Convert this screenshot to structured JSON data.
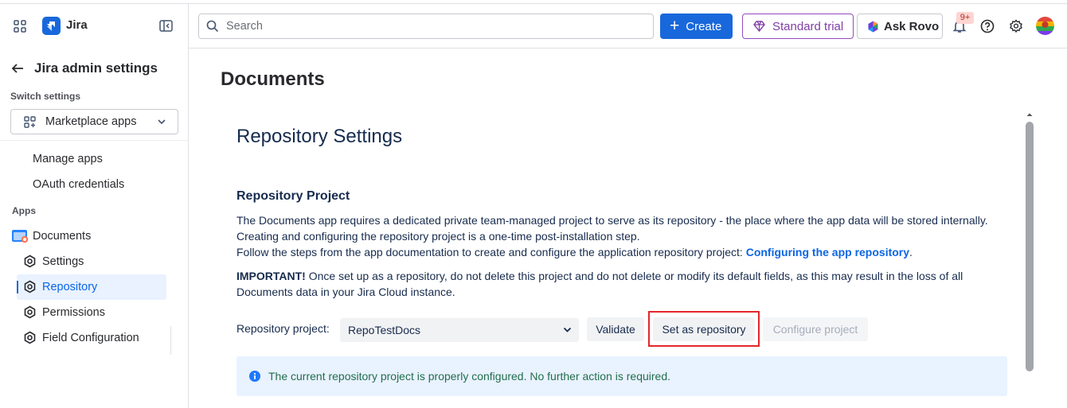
{
  "app": {
    "name": "Jira"
  },
  "sidebar": {
    "back_title": "Jira admin settings",
    "switch_settings_label": "Switch settings",
    "switch_value": "Marketplace apps",
    "items": [
      {
        "label": "Manage apps"
      },
      {
        "label": "OAuth credentials"
      }
    ],
    "apps_label": "Apps",
    "app_name": "Documents",
    "app_items": [
      {
        "label": "Settings",
        "selected": false
      },
      {
        "label": "Repository",
        "selected": true
      },
      {
        "label": "Permissions",
        "selected": false
      },
      {
        "label": "Field Configuration",
        "selected": false
      }
    ]
  },
  "topbar": {
    "search_placeholder": "Search",
    "create_label": "Create",
    "trial_label": "Standard trial",
    "rovo_label": "Ask Rovo",
    "notification_badge": "9+"
  },
  "main": {
    "page_title": "Documents",
    "section_title": "Repository Settings",
    "sub_title": "Repository Project",
    "para1_line1": "The Documents app requires a dedicated private team-managed project to serve as its repository - the place where the app data will be stored internally.",
    "para1_line2": "Creating and configuring the repository project is a one-time post-installation step.",
    "para1_line3_prefix": "Follow the steps from the app documentation to create and configure the application repository project: ",
    "para1_link": "Configuring the app repository",
    "para1_line3_suffix": ".",
    "important_label": "IMPORTANT!",
    "important_line1": " Once set up as a repository, do not delete this project and do not delete or modify its default fields, as this may result in the loss of all",
    "important_line2": "Documents data in your Jira Cloud instance.",
    "repo_label": "Repository project:",
    "repo_value": "RepoTestDocs",
    "validate_label": "Validate",
    "set_repo_label": "Set as repository",
    "configure_label": "Configure project",
    "info_message": "The current repository project is properly configured. No further action is required."
  },
  "colors": {
    "brand": "#1868db",
    "trial": "#803fa5",
    "highlight_box": "#e3262b",
    "info_bg": "#e9f2ff",
    "success_text": "#216e4e"
  }
}
